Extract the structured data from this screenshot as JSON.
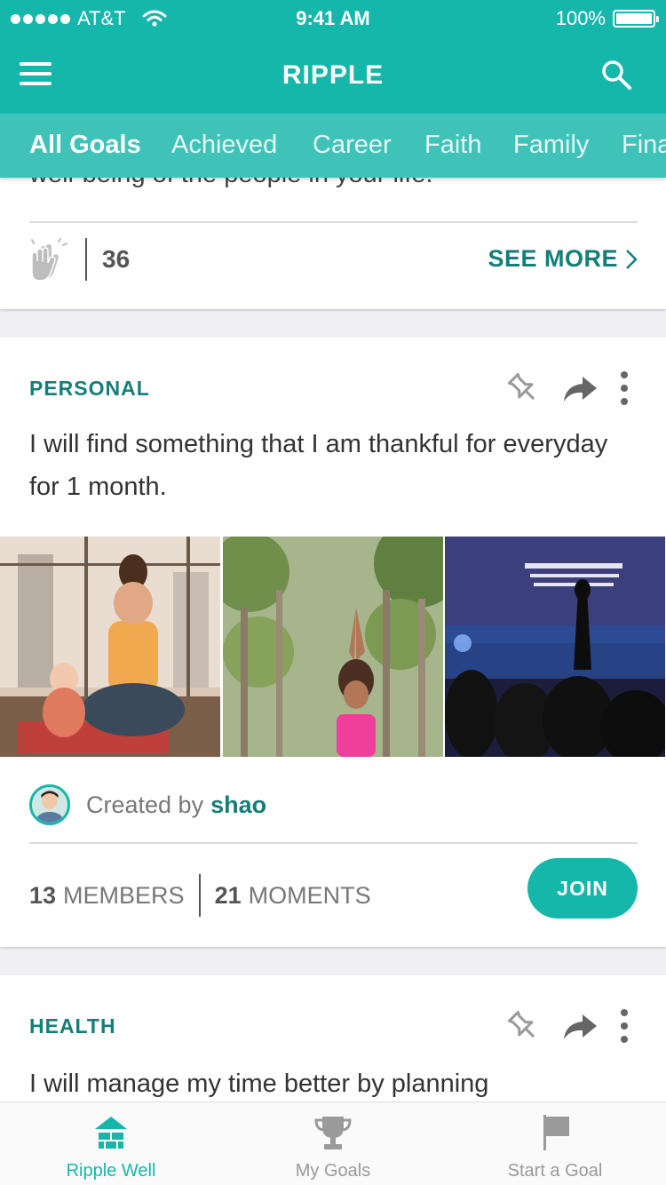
{
  "status_bar": {
    "carrier": "AT&T",
    "time": "9:41 AM",
    "battery": "100%"
  },
  "header": {
    "title": "RIPPLE"
  },
  "tabs": [
    {
      "label": "All Goals",
      "active": true
    },
    {
      "label": "Achieved"
    },
    {
      "label": "Career"
    },
    {
      "label": "Faith"
    },
    {
      "label": "Family"
    },
    {
      "label": "Fina"
    }
  ],
  "card_prev": {
    "text_fragment": "well-being of the people in your life.",
    "clap_count": "36",
    "see_more": "SEE MORE"
  },
  "card_personal": {
    "category": "PERSONAL",
    "goal": "I will find something that I am thankful for everyday for 1 month.",
    "created_by_label": "Created by",
    "creator": "shao",
    "members_count": "13",
    "members_label": "MEMBERS",
    "moments_count": "21",
    "moments_label": "MOMENTS",
    "join": "JOIN"
  },
  "card_health": {
    "category": "HEALTH",
    "goal": "I will manage my time better by planning"
  },
  "tabbar": {
    "ripple_well": "Ripple Well",
    "my_goals": "My Goals",
    "start_goal": "Start a Goal"
  },
  "colors": {
    "accent": "#16b7ab",
    "tab_strip": "#3fc3b8",
    "category_text": "#147e79"
  }
}
